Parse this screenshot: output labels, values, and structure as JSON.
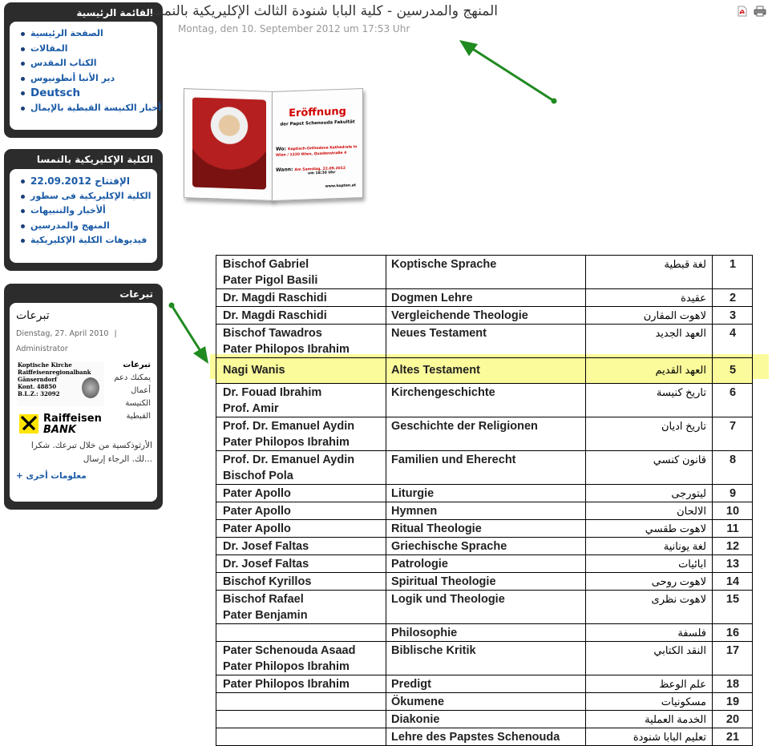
{
  "sidebar": {
    "main_menu": {
      "title": "القائمة الرئيسية",
      "items": [
        "الصفحة الرئيسية",
        "المقالات",
        "الكتاب المقدس",
        "دير الأنبا أنطونيوس",
        "Deutsch",
        "أخبار الكنيسة القبطية بالإيمال"
      ]
    },
    "college_menu": {
      "title": "الكلية الإكليريكية بالنمسا",
      "items": [
        "الإفتتاح 22.09.2012",
        "الكلية الإكليريكية فى سطور",
        "ألأخبار والتنبيهات",
        "المنهج والمدرسين",
        "فيديوهات الكلية الإكليريكية"
      ]
    },
    "donations": {
      "title": "تبرعات",
      "heading": "تبرعات",
      "date": "Dienstag, 27. April 2010",
      "separator": "|",
      "author": "Administrator",
      "bank_card": [
        "Koptische Kirche",
        "Raiffeisenregionalbank",
        "Gänserndorf",
        "Kont. 48850",
        "B.L.Z.: 32092"
      ],
      "side_title": "تبرعات",
      "side_lines": [
        "يمكنك دعم",
        "أعمال",
        "الكنيسة",
        "القبطية"
      ],
      "text_lines": [
        "الأرثوذكسية من خلال تبرعك. شكرا",
        "...لك. الرجاء إرسال"
      ],
      "bank_logo_line1": "Raiffeisen",
      "bank_logo_line2": "BANK",
      "more_link": "معلومات أخرى +"
    }
  },
  "article": {
    "title": "المنهج والمدرسين - كلية البابا شنودة الثالث الإكليريكية بالنمسا",
    "date": "Montag, den 10. September 2012 um 17:53 Uhr",
    "image": {
      "heading": "Eröffnung",
      "subheading": "der Papst Schenouda Fakultät",
      "wo_label": "Wo:",
      "wo_text": "Koptisch-Orthodoxe Kathedrale in Wien / 1220 Wien, Quadenstraße 4",
      "wann_label": "Wann:",
      "wann_text": "Am Samstag, 22.09.2012",
      "time_text": "um 18:30 Uhr",
      "site": "www.kopten.at"
    }
  },
  "table": {
    "rows": [
      {
        "lecturer": [
          "Bischof Gabriel",
          "Pater Pigol Basili"
        ],
        "subject": "Koptische Sprache",
        "arabic": "لغة قبطية",
        "num": "1"
      },
      {
        "lecturer": [
          "Dr. Magdi Raschidi"
        ],
        "subject": "Dogmen Lehre",
        "arabic": "عقيدة",
        "num": "2"
      },
      {
        "lecturer": [
          "Dr. Magdi Raschidi"
        ],
        "subject": "Vergleichende Theologie",
        "arabic": "لاهوت المقارن",
        "num": "3"
      },
      {
        "lecturer": [
          "Bischof Tawadros",
          "Pater Philopos Ibrahim"
        ],
        "subject": "Neues Testament",
        "arabic": "العهد الجديد",
        "num": "4"
      },
      {
        "lecturer": [
          "Nagi Wanis"
        ],
        "subject": "Altes Testament",
        "arabic": "العهد القديم",
        "num": "5",
        "highlight": true
      },
      {
        "lecturer": [
          "Dr. Fouad Ibrahim",
          "Prof. Amir"
        ],
        "subject": "Kirchengeschichte",
        "arabic": "تاريخ كنيسة",
        "num": "6"
      },
      {
        "lecturer": [
          "Prof. Dr. Emanuel Aydin",
          "Pater Philopos Ibrahim"
        ],
        "subject": "Geschichte der Religionen",
        "arabic": "تاريخ اديان",
        "num": "7"
      },
      {
        "lecturer": [
          "Prof. Dr. Emanuel Aydin",
          "Bischof Pola"
        ],
        "subject": "Familien und Eherecht",
        "arabic": "قانون كنسي",
        "num": "8"
      },
      {
        "lecturer": [
          "Pater Apollo"
        ],
        "subject": "Liturgie",
        "arabic": "ليتورجى",
        "num": "9"
      },
      {
        "lecturer": [
          "Pater Apollo"
        ],
        "subject": "Hymnen",
        "arabic": "الالحان",
        "num": "10"
      },
      {
        "lecturer": [
          "Pater Apollo"
        ],
        "subject": "Ritual Theologie",
        "arabic": "لاهوت طقسي",
        "num": "11"
      },
      {
        "lecturer": [
          "Dr. Josef Faltas"
        ],
        "subject": "Griechische Sprache",
        "arabic": "لغة يونانية",
        "num": "12"
      },
      {
        "lecturer": [
          "Dr. Josef Faltas"
        ],
        "subject": "Patrologie",
        "arabic": "ابائيات",
        "num": "13"
      },
      {
        "lecturer": [
          "Bischof Kyrillos"
        ],
        "subject": "Spiritual Theologie",
        "arabic": "لاهوت روحى",
        "num": "14"
      },
      {
        "lecturer": [
          "Bischof Rafael",
          "Pater Benjamin"
        ],
        "subject": "Logik und Theologie",
        "arabic": "لاهوت نظرى",
        "num": "15"
      },
      {
        "lecturer": [],
        "subject": "Philosophie",
        "arabic": "فلسفة",
        "num": "16"
      },
      {
        "lecturer": [
          "Pater Schenouda Asaad",
          "Pater Philopos Ibrahim"
        ],
        "subject": "Biblische Kritik",
        "arabic": "النقد الكتابي",
        "num": "17"
      },
      {
        "lecturer": [
          "Pater Philopos Ibrahim"
        ],
        "subject": "Predigt",
        "arabic": "علم الوعظ",
        "num": "18"
      },
      {
        "lecturer": [],
        "subject": "Ökumene",
        "arabic": "مسكونيات",
        "num": "19"
      },
      {
        "lecturer": [],
        "subject": "Diakonie",
        "arabic": "الخدمة العملية",
        "num": "20"
      },
      {
        "lecturer": [],
        "subject": "Lehre des Papstes Schenouda",
        "arabic": "تعليم البابا شنودة",
        "num": "21"
      }
    ]
  },
  "colors": {
    "module_bg": "#2c2c2c",
    "link": "#1a5aa6",
    "highlight": "#fbfb9b",
    "arrow": "#1f8a1f"
  }
}
